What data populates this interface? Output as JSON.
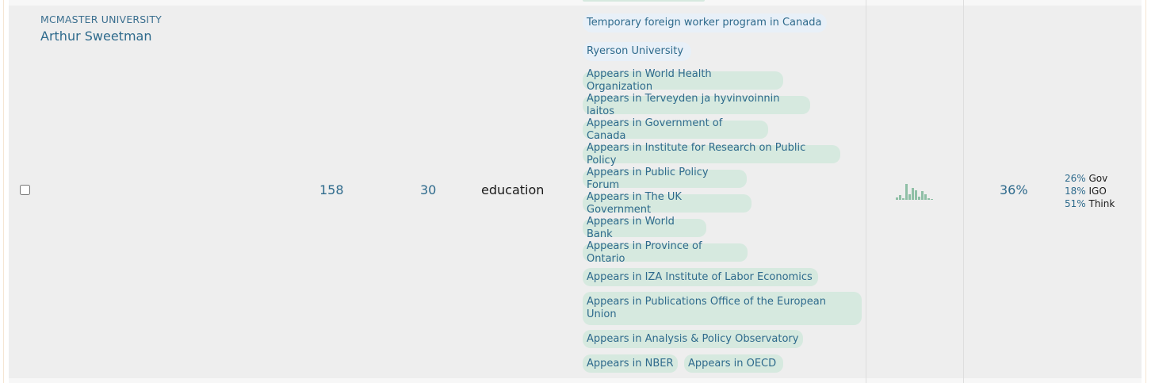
{
  "row": {
    "affiliation": "MCMASTER UNIVERSITY",
    "name": "Arthur Sweetman",
    "count_a": "158",
    "count_b": "30",
    "topic": "education",
    "percent": "36%",
    "distribution": [
      {
        "pct": "26%",
        "label": "Gov"
      },
      {
        "pct": "18%",
        "label": "IGO"
      },
      {
        "pct": "51%",
        "label": "Think"
      }
    ],
    "sparkline_color": "#8fbfa6",
    "blue_tags": [
      "Temporary foreign worker program in Canada",
      "Ryerson University"
    ],
    "green_tags": [
      "Appears in World Health Organization",
      "Appears in Terveyden ja hyvinvoinnin laitos",
      "Appears in Government of Canada",
      "Appears in Institute for Research on Public Policy",
      "Appears in Public Policy Forum",
      "Appears in The UK Government",
      "Appears in World Bank",
      "Appears in Province of Ontario",
      "Appears in IZA Institute of Labor Economics",
      "Appears in Publications Office of the European Union",
      "Appears in Analysis & Policy Observatory",
      "Appears in NBER",
      "Appears in OECD"
    ]
  },
  "colors": {
    "link": "#2e6a8c",
    "row_bg": "#eeeeee",
    "tag_green": "#d6e9df",
    "tag_blue": "#e8f0f8"
  }
}
